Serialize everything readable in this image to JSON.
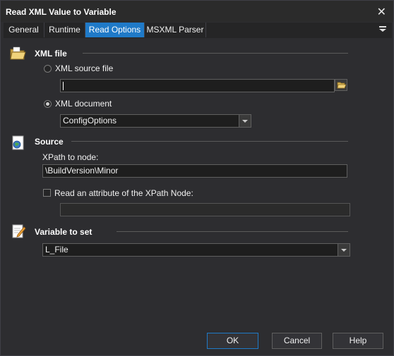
{
  "window": {
    "title": "Read XML Value to Variable"
  },
  "tabs": [
    {
      "label": "General"
    },
    {
      "label": "Runtime"
    },
    {
      "label": "Read Options"
    },
    {
      "label": "MSXML Parser"
    }
  ],
  "xml_file": {
    "title": "XML file",
    "source_file_label": "XML source file",
    "source_file_value": "",
    "document_label": "XML document",
    "document_value": "ConfigOptions",
    "selected_option": "XML document"
  },
  "source": {
    "title": "Source",
    "xpath_label": "XPath to node:",
    "xpath_value": "\\BuildVersion\\Minor",
    "attribute_label": "Read an attribute of the XPath Node:",
    "attribute_checked": false,
    "attribute_value": ""
  },
  "variable": {
    "title": "Variable to set",
    "value": "L_File"
  },
  "buttons": {
    "ok": "OK",
    "cancel": "Cancel",
    "help": "Help"
  },
  "colors": {
    "accent": "#1f7ac8",
    "background": "#2d2d30",
    "field": "#1e1e1e"
  }
}
